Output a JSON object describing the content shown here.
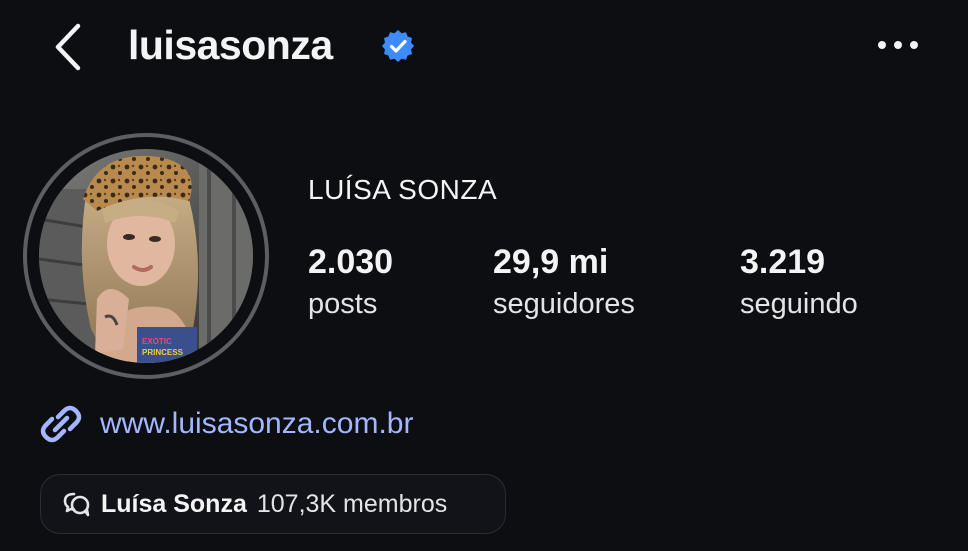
{
  "header": {
    "username": "luisasonza",
    "verified": true,
    "back_icon": "chevron-left-icon",
    "more_icon": "more-horizontal-icon"
  },
  "profile": {
    "display_name": "LUÍSA SONZA",
    "avatar_label": "EXOTIC PRINCESS",
    "stats": [
      {
        "value": "2.030",
        "label": "posts"
      },
      {
        "value": "29,9 mi",
        "label": "seguidores"
      },
      {
        "value": "3.219",
        "label": "seguindo"
      }
    ],
    "website": "www.luisasonza.com.br",
    "link_icon": "link-icon"
  },
  "channel": {
    "icon": "chat-bubbles-icon",
    "name": "Luísa Sonza",
    "members": "107,3K membros"
  },
  "colors": {
    "background": "#0d0e12",
    "link": "#a3b6ff",
    "verified": "#3d8bff",
    "ring": "#5d5e63"
  }
}
